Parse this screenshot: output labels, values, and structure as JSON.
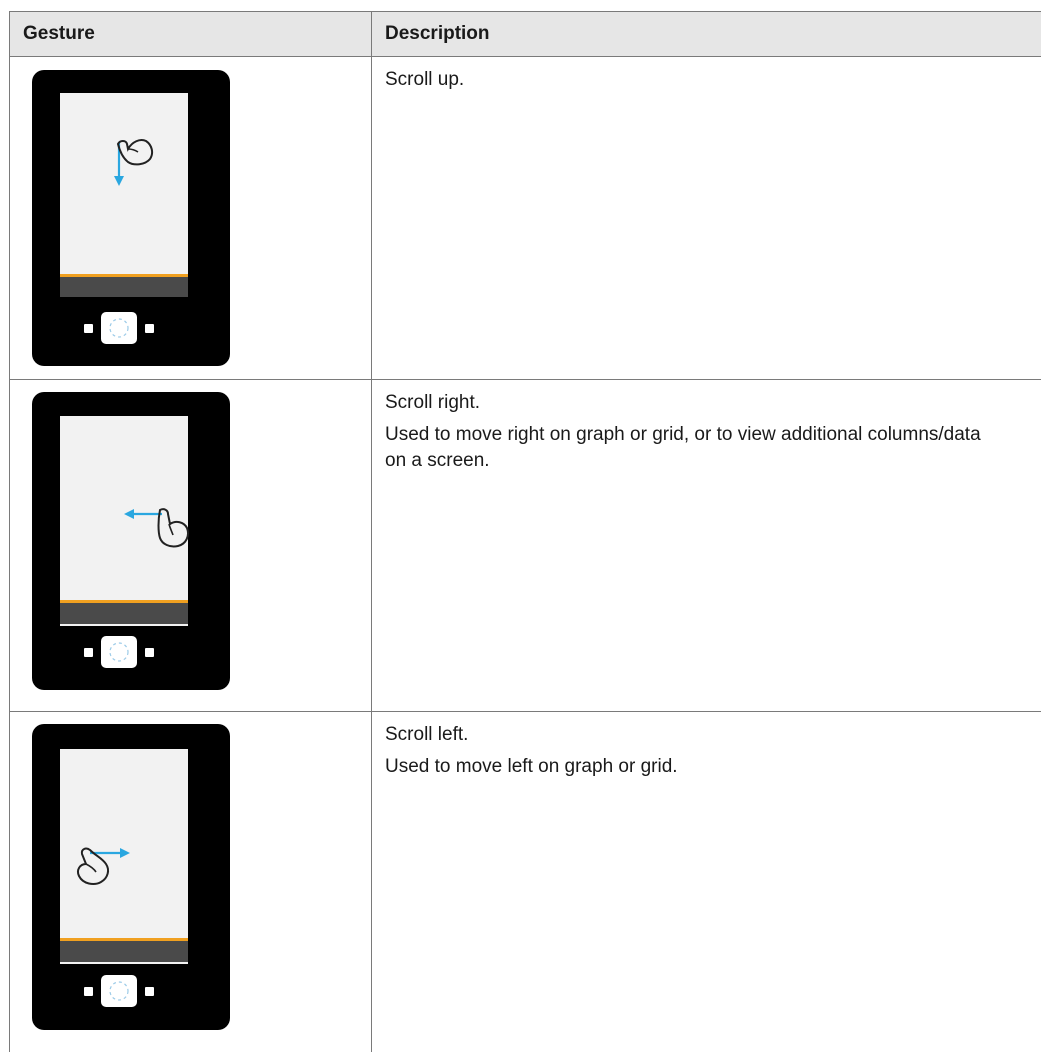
{
  "table": {
    "headers": {
      "gesture": "Gesture",
      "description": "Description"
    },
    "rows": [
      {
        "gesture_icon": "scroll-up-gesture-icon",
        "description": [
          "Scroll up."
        ]
      },
      {
        "gesture_icon": "scroll-right-gesture-icon",
        "description": [
          "Scroll right.",
          "Used to move right on graph or grid, or to view additional columns/data on a screen."
        ]
      },
      {
        "gesture_icon": "scroll-left-gesture-icon",
        "description": [
          "Scroll left.",
          "Used to move left on graph or grid."
        ]
      }
    ]
  },
  "colors": {
    "header_bg": "#e6e6e6",
    "device_body": "#000000",
    "screen": "#f2f2f2",
    "accent_bar": "#f0a020",
    "status_bar": "#4a4a4a",
    "arrow": "#2aa7e0"
  }
}
